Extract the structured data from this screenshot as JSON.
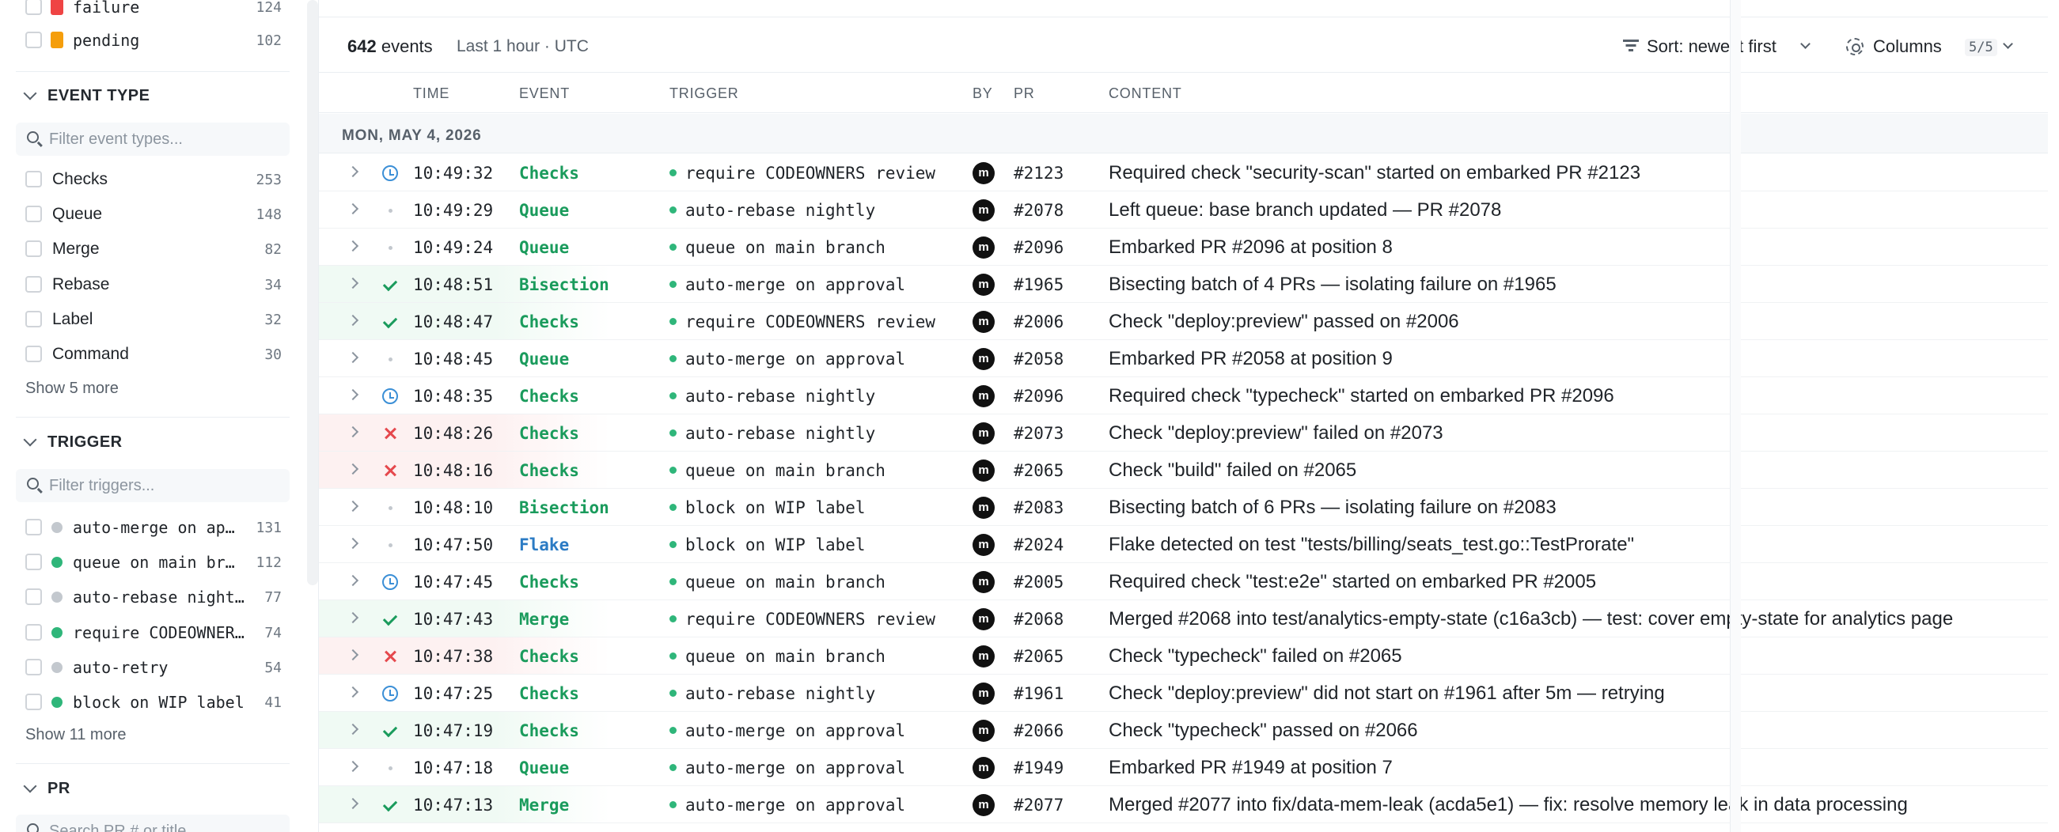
{
  "sidebar": {
    "status_items": [
      {
        "label": "failure",
        "count": "124",
        "color": "#ef4444"
      },
      {
        "label": "pending",
        "count": "102",
        "color": "#f59e0b"
      }
    ],
    "event_type": {
      "title": "EVENT TYPE",
      "placeholder": "Filter event types...",
      "items": [
        {
          "label": "Checks",
          "count": "253"
        },
        {
          "label": "Queue",
          "count": "148"
        },
        {
          "label": "Merge",
          "count": "82"
        },
        {
          "label": "Rebase",
          "count": "34"
        },
        {
          "label": "Label",
          "count": "32"
        },
        {
          "label": "Command",
          "count": "30"
        }
      ],
      "show_more": "Show 5 more"
    },
    "trigger": {
      "title": "TRIGGER",
      "placeholder": "Filter triggers...",
      "items": [
        {
          "label": "auto-merge on ap…",
          "count": "131",
          "dot": "#c3c8ce"
        },
        {
          "label": "queue on main br…",
          "count": "112",
          "dot": "#2fb67a"
        },
        {
          "label": "auto-rebase night…",
          "count": "77",
          "dot": "#c3c8ce"
        },
        {
          "label": "require CODEOWNER…",
          "count": "74",
          "dot": "#2fb67a"
        },
        {
          "label": "auto-retry",
          "count": "54",
          "dot": "#c3c8ce"
        },
        {
          "label": "block on WIP label",
          "count": "41",
          "dot": "#2fb67a"
        }
      ],
      "show_more": "Show 11 more"
    },
    "pr": {
      "title": "PR",
      "placeholder": "Search PR # or title"
    }
  },
  "summary": {
    "count": "642",
    "count_suffix": "events",
    "range": "Last 1 hour  ·  UTC"
  },
  "toolbar": {
    "sort_label": "Sort: newest first",
    "columns_label": "Columns",
    "columns_badge": "5/5"
  },
  "columns": {
    "time": "TIME",
    "event": "EVENT",
    "trigger": "TRIGGER",
    "by": "BY",
    "pr": "PR",
    "content": "CONTENT"
  },
  "date_group": "MON, MAY 4, 2026",
  "event_colors": {
    "Checks": "#1a9b5c",
    "Queue": "#1a9b5c",
    "Bisection": "#1a9b5c",
    "Merge": "#1a9b5c",
    "Flake": "#2b7bc4"
  },
  "rows": [
    {
      "status": "pending",
      "time": "10:49:32",
      "event": "Checks",
      "trigger": "require CODEOWNERS review",
      "by": "m",
      "pr": "#2123",
      "content": "Required check \"security-scan\" started on embarked PR #2123"
    },
    {
      "status": "neutral",
      "time": "10:49:29",
      "event": "Queue",
      "trigger": "auto-rebase nightly",
      "by": "m",
      "pr": "#2078",
      "content": "Left queue: base branch updated — PR #2078"
    },
    {
      "status": "neutral",
      "time": "10:49:24",
      "event": "Queue",
      "trigger": "queue on main branch",
      "by": "m",
      "pr": "#2096",
      "content": "Embarked PR #2096 at position 8"
    },
    {
      "status": "success",
      "time": "10:48:51",
      "event": "Bisection",
      "trigger": "auto-merge on approval",
      "by": "m",
      "pr": "#1965",
      "content": "Bisecting batch of 4 PRs — isolating failure on #1965"
    },
    {
      "status": "success",
      "time": "10:48:47",
      "event": "Checks",
      "trigger": "require CODEOWNERS review",
      "by": "m",
      "pr": "#2006",
      "content": "Check \"deploy:preview\" passed on #2006"
    },
    {
      "status": "neutral",
      "time": "10:48:45",
      "event": "Queue",
      "trigger": "auto-merge on approval",
      "by": "m",
      "pr": "#2058",
      "content": "Embarked PR #2058 at position 9"
    },
    {
      "status": "pending",
      "time": "10:48:35",
      "event": "Checks",
      "trigger": "auto-rebase nightly",
      "by": "m",
      "pr": "#2096",
      "content": "Required check \"typecheck\" started on embarked PR #2096"
    },
    {
      "status": "failure",
      "time": "10:48:26",
      "event": "Checks",
      "trigger": "auto-rebase nightly",
      "by": "m",
      "pr": "#2073",
      "content": "Check \"deploy:preview\" failed on #2073"
    },
    {
      "status": "failure",
      "time": "10:48:16",
      "event": "Checks",
      "trigger": "queue on main branch",
      "by": "m",
      "pr": "#2065",
      "content": "Check \"build\" failed on #2065"
    },
    {
      "status": "neutral",
      "time": "10:48:10",
      "event": "Bisection",
      "trigger": "block on WIP label",
      "by": "m",
      "pr": "#2083",
      "content": "Bisecting batch of 6 PRs — isolating failure on #2083"
    },
    {
      "status": "neutral",
      "time": "10:47:50",
      "event": "Flake",
      "trigger": "block on WIP label",
      "by": "m",
      "pr": "#2024",
      "content": "Flake detected on test \"tests/billing/seats_test.go::TestProrate\""
    },
    {
      "status": "pending",
      "time": "10:47:45",
      "event": "Checks",
      "trigger": "queue on main branch",
      "by": "m",
      "pr": "#2005",
      "content": "Required check \"test:e2e\" started on embarked PR #2005"
    },
    {
      "status": "success",
      "time": "10:47:43",
      "event": "Merge",
      "trigger": "require CODEOWNERS review",
      "by": "m",
      "pr": "#2068",
      "content": "Merged #2068 into test/analytics-empty-state (c16a3cb) — test: cover empty-state for analytics page"
    },
    {
      "status": "failure",
      "time": "10:47:38",
      "event": "Checks",
      "trigger": "queue on main branch",
      "by": "m",
      "pr": "#2065",
      "content": "Check \"typecheck\" failed on #2065"
    },
    {
      "status": "pending",
      "time": "10:47:25",
      "event": "Checks",
      "trigger": "auto-rebase nightly",
      "by": "m",
      "pr": "#1961",
      "content": "Check \"deploy:preview\" did not start on #1961 after 5m — retrying"
    },
    {
      "status": "success",
      "time": "10:47:19",
      "event": "Checks",
      "trigger": "auto-merge on approval",
      "by": "m",
      "pr": "#2066",
      "content": "Check \"typecheck\" passed on #2066"
    },
    {
      "status": "neutral",
      "time": "10:47:18",
      "event": "Queue",
      "trigger": "auto-merge on approval",
      "by": "m",
      "pr": "#1949",
      "content": "Embarked PR #1949 at position 7"
    },
    {
      "status": "success",
      "time": "10:47:13",
      "event": "Merge",
      "trigger": "auto-merge on approval",
      "by": "m",
      "pr": "#2077",
      "content": "Merged #2077 into fix/data-mem-leak (acda5e1) — fix: resolve memory leak in data processing"
    }
  ]
}
